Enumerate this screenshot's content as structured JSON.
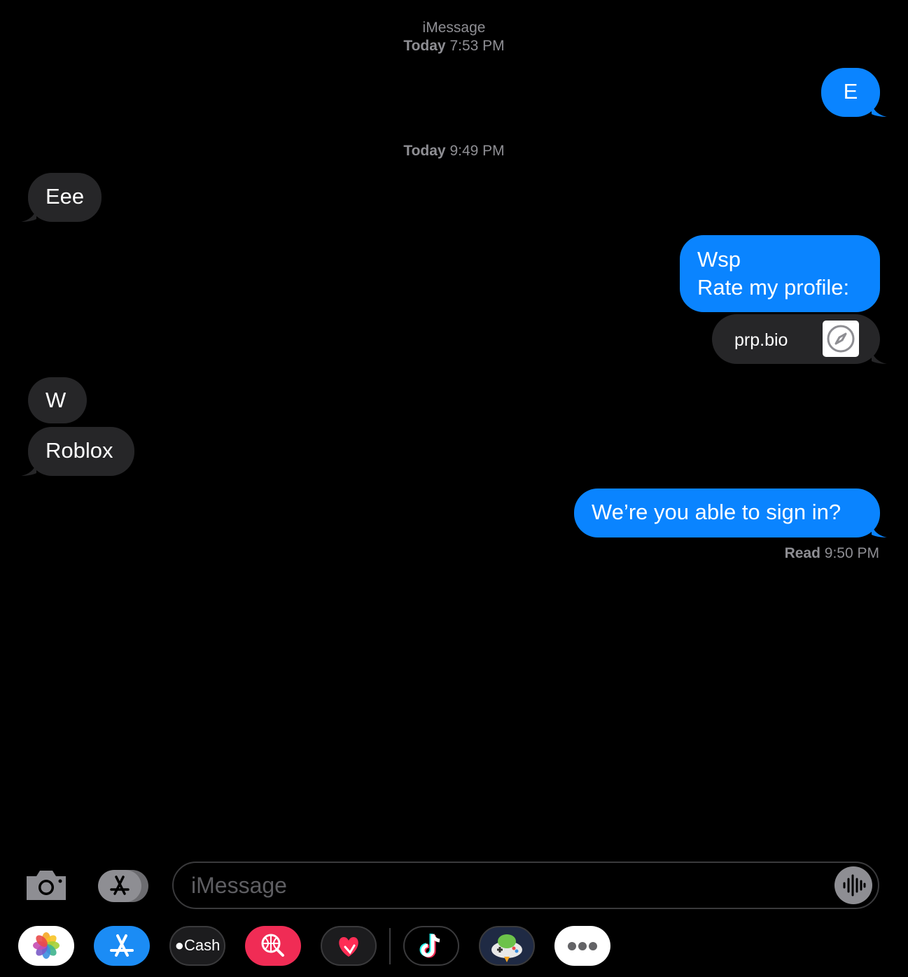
{
  "header": {
    "service": "iMessage",
    "first_timestamp_day": "Today",
    "first_timestamp_time": "7:53 PM"
  },
  "messages": {
    "m1": "E",
    "divider_day": "Today",
    "divider_time": "9:49 PM",
    "m2": "Eee",
    "m3_line1": "Wsp",
    "m3_line2": "Rate my profile:",
    "link_title": "prp.bio",
    "m4": "W",
    "m5": "Roblox",
    "m6": "We’re you able to sign in?",
    "receipt_label": "Read",
    "receipt_time": "9:50 PM"
  },
  "composer": {
    "placeholder": "iMessage"
  },
  "app_drawer": {
    "items": [
      "photos-icon",
      "app-store-icon",
      "apple-cash-icon",
      "web-search-icon",
      "digital-touch-icon",
      "tiktok-icon",
      "game-pigeon-icon",
      "more-icon"
    ],
    "cash_label": "Cash"
  },
  "colors": {
    "sent_bubble": "#0a84ff",
    "received_bubble": "#262628",
    "timestamp": "#8e8e93"
  }
}
